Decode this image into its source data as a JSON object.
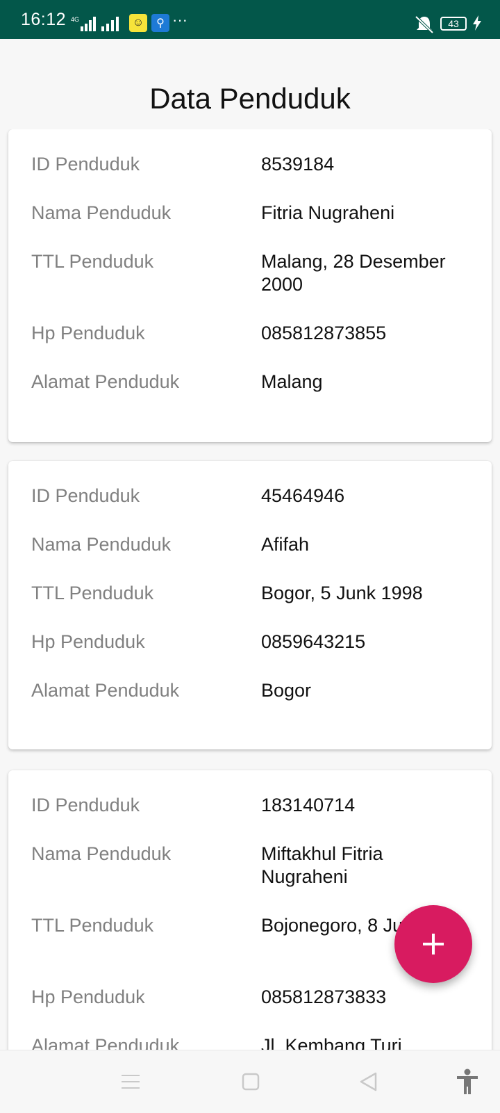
{
  "status_bar": {
    "time": "16:12",
    "network": "4G",
    "battery": "43",
    "overflow": "···"
  },
  "page": {
    "title": "Data Penduduk"
  },
  "cards": [
    {
      "rows": [
        {
          "label": "ID Penduduk",
          "value": "8539184"
        },
        {
          "label": "Nama Penduduk",
          "value": "Fitria Nugraheni"
        },
        {
          "label": "TTL Penduduk",
          "value": "Malang, 28 Desember 2000"
        },
        {
          "label": "Hp Penduduk",
          "value": "085812873855"
        },
        {
          "label": "Alamat Penduduk",
          "value": "Malang"
        }
      ]
    },
    {
      "rows": [
        {
          "label": "ID Penduduk",
          "value": "45464946"
        },
        {
          "label": "Nama Penduduk",
          "value": "Afifah"
        },
        {
          "label": "TTL Penduduk",
          "value": "Bogor, 5 Junk 1998"
        },
        {
          "label": "Hp Penduduk",
          "value": "0859643215"
        },
        {
          "label": "Alamat Penduduk",
          "value": "Bogor"
        }
      ]
    },
    {
      "rows": [
        {
          "label": "ID Penduduk",
          "value": "183140714"
        },
        {
          "label": "Nama Penduduk",
          "value": "Miftakhul Fitria Nugraheni"
        },
        {
          "label": "TTL Penduduk",
          "value": "Bojonegoro, 8 Juni 2000"
        },
        {
          "label": "Hp Penduduk",
          "value": "085812873833"
        },
        {
          "label": "Alamat Penduduk",
          "value": "Jl. Kembang Turi"
        }
      ]
    }
  ],
  "fab": {
    "icon": "plus-icon",
    "color": "#d81b60"
  },
  "colors": {
    "status_bar": "#03574a",
    "label": "#808080",
    "value": "#111111"
  },
  "nav_bar": {
    "icons": [
      "menu-icon",
      "home-square-icon",
      "back-triangle-icon",
      "accessibility-icon"
    ]
  }
}
